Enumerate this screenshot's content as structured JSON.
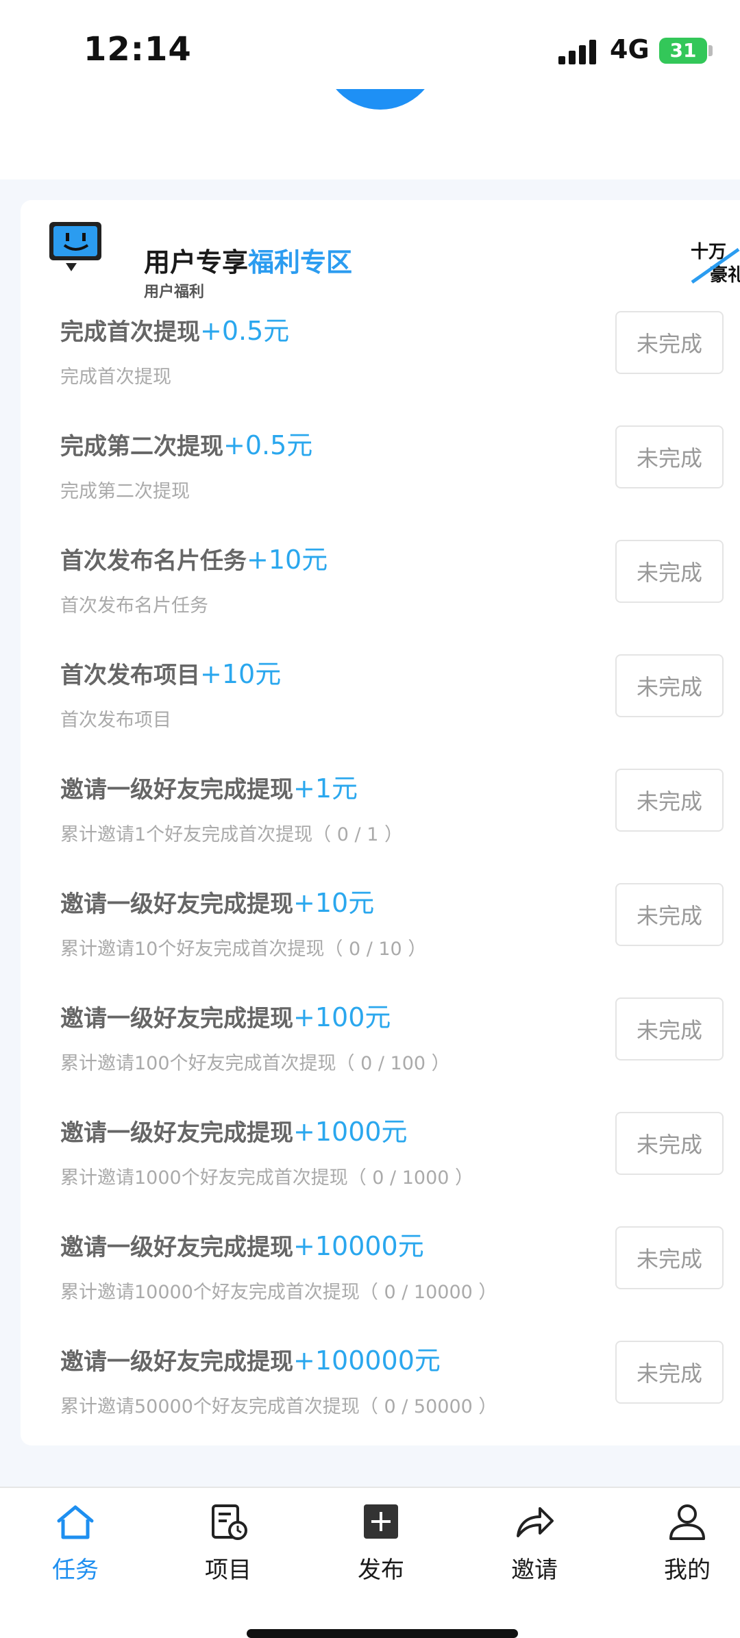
{
  "status": {
    "time": "12:14",
    "network": "4G",
    "battery": "31"
  },
  "header": {
    "title_main": "用户专享",
    "title_highlight": "福利专区",
    "subtitle": "用户福利",
    "badge_text": "十万豪礼"
  },
  "tasks": [
    {
      "title": "完成首次提现",
      "reward": "+0.5元",
      "desc": "完成首次提现",
      "button": "未完成"
    },
    {
      "title": "完成第二次提现",
      "reward": "+0.5元",
      "desc": "完成第二次提现",
      "button": "未完成"
    },
    {
      "title": "首次发布名片任务",
      "reward": "+10元",
      "desc": "首次发布名片任务",
      "button": "未完成"
    },
    {
      "title": "首次发布项目",
      "reward": "+10元",
      "desc": "首次发布项目",
      "button": "未完成"
    },
    {
      "title": "邀请一级好友完成提现",
      "reward": "+1元",
      "desc": "累计邀请1个好友完成首次提现（ 0 / 1 ）",
      "button": "未完成"
    },
    {
      "title": "邀请一级好友完成提现",
      "reward": "+10元",
      "desc": "累计邀请10个好友完成首次提现（ 0 / 10 ）",
      "button": "未完成"
    },
    {
      "title": "邀请一级好友完成提现",
      "reward": "+100元",
      "desc": "累计邀请100个好友完成首次提现（ 0 / 100 ）",
      "button": "未完成"
    },
    {
      "title": "邀请一级好友完成提现",
      "reward": "+1000元",
      "desc": "累计邀请1000个好友完成首次提现（ 0 / 1000 ）",
      "button": "未完成"
    },
    {
      "title": "邀请一级好友完成提现",
      "reward": "+10000元",
      "desc": "累计邀请10000个好友完成首次提现（ 0 / 10000 ）",
      "button": "未完成"
    },
    {
      "title": "邀请一级好友完成提现",
      "reward": "+100000元",
      "desc": "累计邀请50000个好友完成首次提现（ 0 / 50000 ）",
      "button": "未完成"
    }
  ],
  "tabbar": {
    "items": [
      {
        "label": "任务",
        "icon": "home-icon",
        "active": true
      },
      {
        "label": "项目",
        "icon": "project-clock-icon",
        "active": false
      },
      {
        "label": "发布",
        "icon": "plus-square-icon",
        "active": false
      },
      {
        "label": "邀请",
        "icon": "share-arrow-icon",
        "active": false
      },
      {
        "label": "我的",
        "icon": "user-icon",
        "active": false
      }
    ]
  },
  "colors": {
    "accent": "#1e8ff0",
    "reward": "#2aa7ee",
    "battery": "#33c759"
  }
}
